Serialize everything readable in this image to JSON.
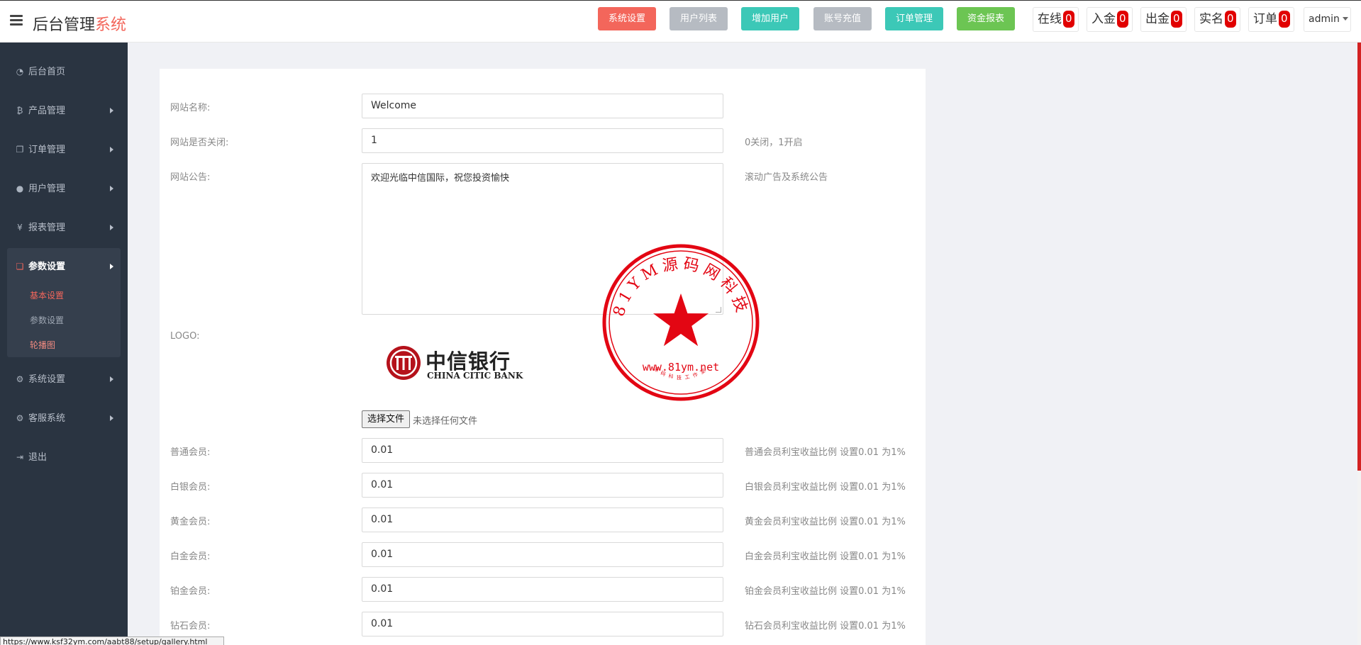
{
  "header": {
    "title_main": "后台管理",
    "title_accent": "系统",
    "buttons": [
      {
        "label": "系统设置",
        "color": "#f3665b"
      },
      {
        "label": "用户列表",
        "color": "#b6bbc2"
      },
      {
        "label": "增加用户",
        "color": "#3cc8b7"
      },
      {
        "label": "账号充值",
        "color": "#b6bbc2"
      },
      {
        "label": "订单管理",
        "color": "#3cc8b7"
      },
      {
        "label": "资金报表",
        "color": "#6cc553"
      }
    ],
    "stats": [
      {
        "label": "在线",
        "count": "0"
      },
      {
        "label": "入金",
        "count": "0"
      },
      {
        "label": "出金",
        "count": "0"
      },
      {
        "label": "实名",
        "count": "0"
      },
      {
        "label": "订单",
        "count": "0"
      }
    ],
    "user": "admin"
  },
  "sidebar": {
    "items": [
      {
        "label": "后台首页",
        "icon": "dashboard-icon"
      },
      {
        "label": "产品管理",
        "icon": "bitcoin-icon"
      },
      {
        "label": "订单管理",
        "icon": "copy-icon"
      },
      {
        "label": "用户管理",
        "icon": "user-icon"
      },
      {
        "label": "报表管理",
        "icon": "yen-icon"
      },
      {
        "label": "参数设置",
        "icon": "files-icon"
      },
      {
        "label": "系统设置",
        "icon": "gears-icon"
      },
      {
        "label": "客服系统",
        "icon": "gears-icon"
      },
      {
        "label": "退出",
        "icon": "sign-out-icon"
      }
    ],
    "sub_items": [
      "基本设置",
      "参数设置",
      "轮播图"
    ]
  },
  "form": {
    "site_name": {
      "label": "网站名称:",
      "value": "Welcome"
    },
    "site_closed": {
      "label": "网站是否关闭:",
      "value": "1",
      "help": "0关闭，1开启"
    },
    "notice": {
      "label": "网站公告:",
      "value": "欢迎光临中信国际，祝您投资愉快",
      "help": "滚动广告及系统公告"
    },
    "logo": {
      "label": "LOGO:",
      "brand_cn": "中信银行",
      "brand_en": "CHINA CITIC BANK",
      "file_button": "选择文件",
      "file_status": "未选择任何文件"
    },
    "members": [
      {
        "label": "普通会员:",
        "value": "0.01",
        "help": "普通会员利宝收益比例 设置0.01 为1%"
      },
      {
        "label": "白银会员:",
        "value": "0.01",
        "help": "白银会员利宝收益比例 设置0.01 为1%"
      },
      {
        "label": "黄金会员:",
        "value": "0.01",
        "help": "黄金会员利宝收益比例 设置0.01 为1%"
      },
      {
        "label": "白金会员:",
        "value": "0.01",
        "help": "白金会员利宝收益比例 设置0.01 为1%"
      },
      {
        "label": "铂金会员:",
        "value": "0.01",
        "help": "铂金会员利宝收益比例 设置0.01 为1%"
      },
      {
        "label": "钻石会员:",
        "value": "0.01",
        "help": "钻石会员利宝收益比例 设置0.01 为1%"
      }
    ]
  },
  "seal": {
    "arc_text": "81YM源码网科技",
    "url": "www.81ym.net",
    "small_text": "源码科技工作室",
    "color": "#e30613"
  },
  "status_url": "https://www.ksf32ym.com/aabt88/setup/gallery.html"
}
